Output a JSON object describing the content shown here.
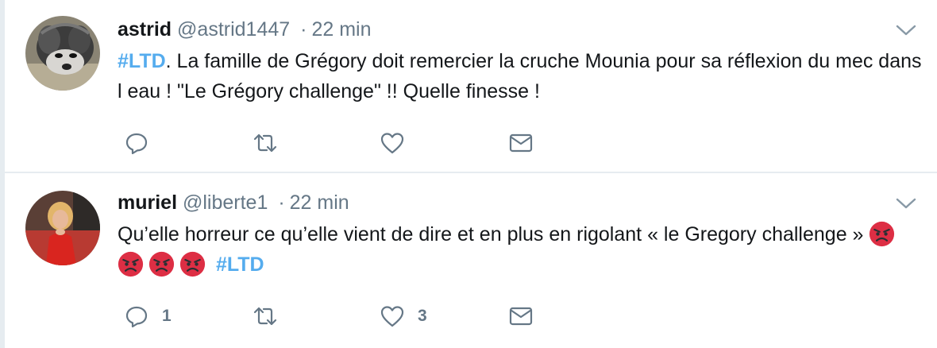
{
  "tweets": [
    {
      "author_name": "astrid",
      "author_handle": "@astrid1447",
      "separator": "·",
      "time": "22 min",
      "hashtag": "#LTD",
      "text_after_hashtag": ". La famille de Grégory doit remercier la cruche Mounia pour sa réflexion du mec dans l eau ! \"Le Grégory challenge\" !! Quelle finesse !",
      "avatar": "dog-avatar",
      "reply_count": "",
      "like_count": ""
    },
    {
      "author_name": "muriel",
      "author_handle": "@liberte1",
      "separator": "·",
      "time": "22 min",
      "text": "Qu’elle horreur ce qu’elle vient de dire et en plus en rigolant « le Gregory challenge » ",
      "emojis": [
        "angry-face",
        "angry-face",
        "angry-face",
        "angry-face"
      ],
      "hashtag": "#LTD",
      "avatar": "woman-avatar",
      "reply_count": "1",
      "like_count": "3"
    }
  ],
  "icons": {
    "reply": "reply-icon",
    "retweet": "retweet-icon",
    "like": "heart-icon",
    "dm": "envelope-icon",
    "caret": "chevron-down-icon"
  },
  "colors": {
    "hashtag": "#55acee",
    "secondary_text": "#657786",
    "primary_text": "#14171a",
    "divider": "#e6ecf0",
    "emoji_red": "#dd2e44"
  }
}
